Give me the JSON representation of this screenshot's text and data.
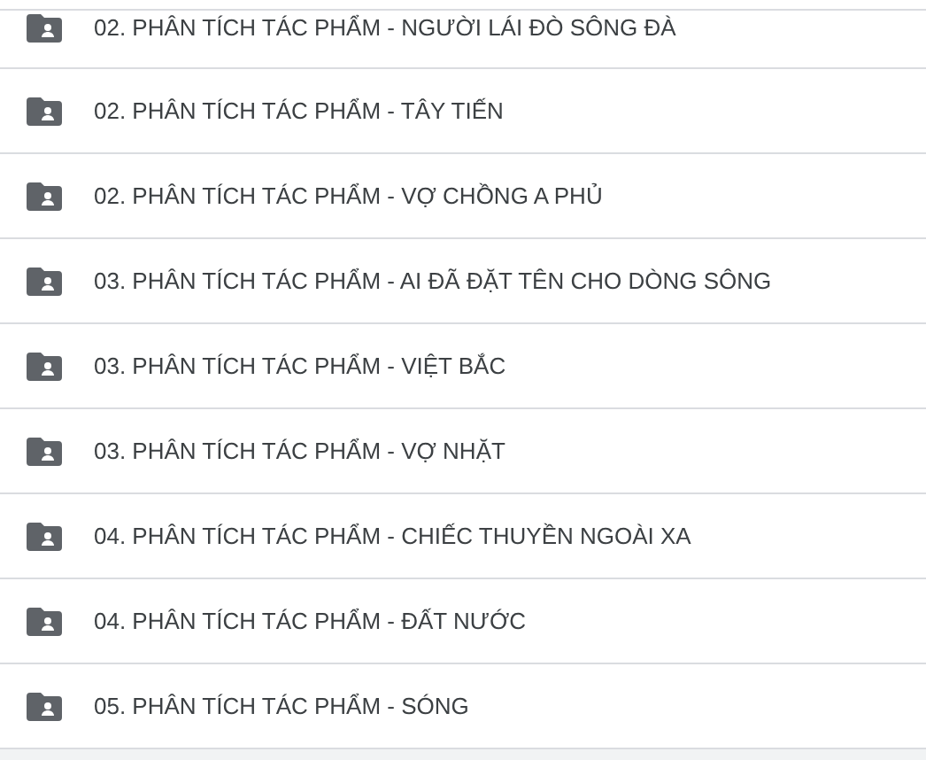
{
  "folders": [
    {
      "name": "02. PHÂN TÍCH TÁC PHẨM - NGƯỜI LÁI ĐÒ SÔNG ĐÀ"
    },
    {
      "name": "02. PHÂN TÍCH TÁC PHẨM - TÂY TIẾN"
    },
    {
      "name": "02. PHÂN TÍCH TÁC PHẨM - VỢ CHỒNG A PHỦ"
    },
    {
      "name": "03. PHÂN TÍCH TÁC PHẨM - AI ĐÃ ĐẶT TÊN CHO DÒNG SÔNG"
    },
    {
      "name": "03. PHÂN TÍCH TÁC PHẨM - VIỆT BẮC"
    },
    {
      "name": "03. PHÂN TÍCH TÁC PHẨM - VỢ NHẶT"
    },
    {
      "name": "04. PHÂN TÍCH TÁC PHẨM - CHIẾC THUYỀN NGOÀI XA"
    },
    {
      "name": "04. PHÂN TÍCH TÁC PHẨM - ĐẤT NƯỚC"
    },
    {
      "name": "05. PHÂN TÍCH TÁC PHẨM - SÓNG"
    }
  ]
}
